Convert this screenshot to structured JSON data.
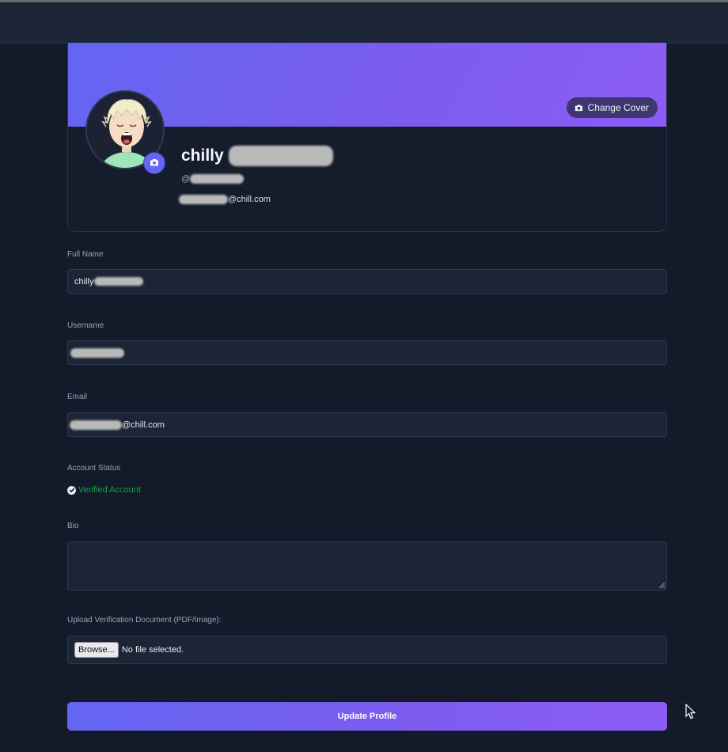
{
  "profile": {
    "display_name": "chilly",
    "handle_prefix": "@",
    "email_suffix": "@chill.com",
    "change_cover_label": "Change Cover",
    "cover_gradient": [
      "#6366f1",
      "#8b5cf6"
    ]
  },
  "form": {
    "full_name_label": "Full Name",
    "full_name_value": "chilly",
    "username_label": "Username",
    "email_label": "Email",
    "email_value_suffix": "@chill.com",
    "account_status_label": "Account Status",
    "account_status_value": "Verified Account",
    "account_status_color": "#1f9d43",
    "bio_label": "Bio",
    "bio_value": "",
    "upload_label": "Upload Verification Document (PDF/Image):",
    "browse_label": "Browse...",
    "no_file_text": "No file selected.",
    "submit_label": "Update Profile"
  },
  "icons": {
    "cover_camera": "camera-icon",
    "avatar_camera": "camera-icon",
    "status_check": "check-circle-icon",
    "cursor": "mouse-pointer-icon"
  }
}
